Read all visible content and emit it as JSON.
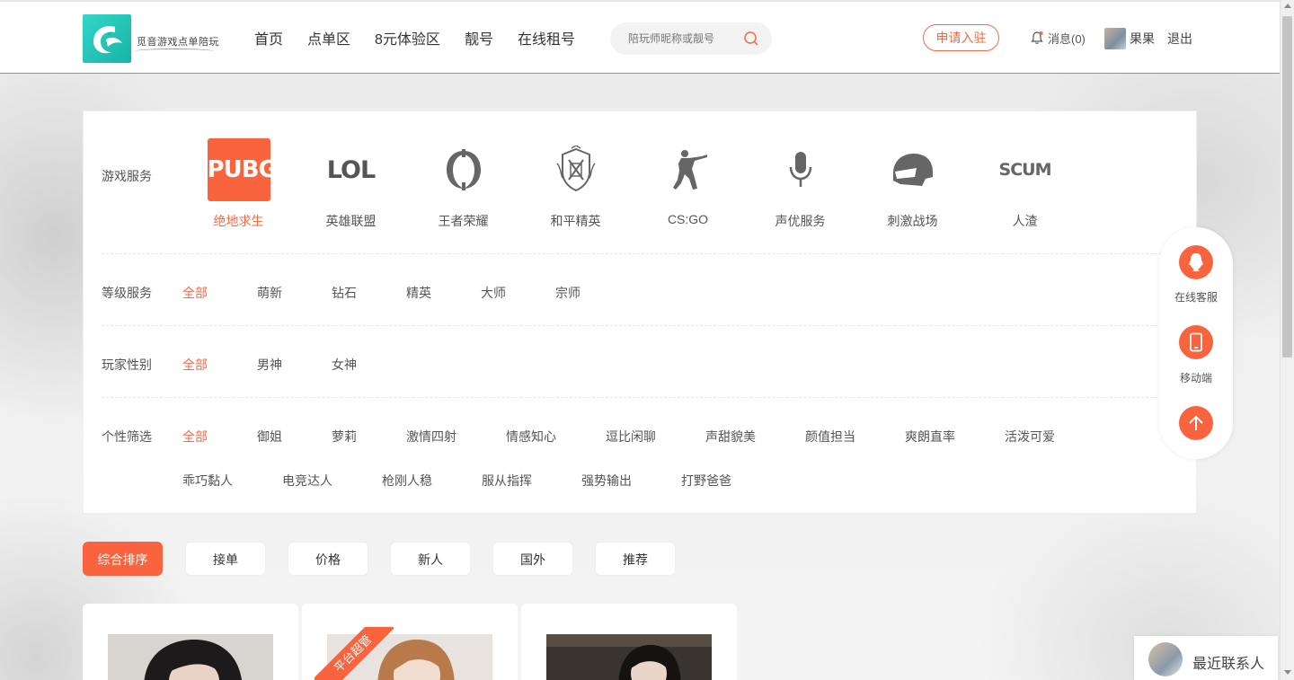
{
  "header": {
    "logo_text": "觅音游戏点单陪玩",
    "nav": [
      "首页",
      "点单区",
      "8元体验区",
      "靓号",
      "在线租号"
    ],
    "search_placeholder": "陪玩师昵称或靓号",
    "apply_label": "申请入驻",
    "message_label": "消息(0)",
    "username": "果果",
    "logout_label": "退出"
  },
  "filters": {
    "game_label": "游戏服务",
    "games": [
      {
        "name": "绝地求生",
        "icon": "pubg-logo",
        "active": true
      },
      {
        "name": "英雄联盟",
        "icon": "lol-logo",
        "active": false
      },
      {
        "name": "王者荣耀",
        "icon": "honor-of-kings-logo",
        "active": false
      },
      {
        "name": "和平精英",
        "icon": "peace-elite-logo",
        "active": false
      },
      {
        "name": "CS:GO",
        "icon": "csgo-logo",
        "active": false
      },
      {
        "name": "声优服务",
        "icon": "microphone-icon",
        "active": false
      },
      {
        "name": "刺激战场",
        "icon": "helmet-icon",
        "active": false
      },
      {
        "name": "人渣",
        "icon": "scum-logo",
        "active": false
      }
    ],
    "game_logo_text": {
      "pubg": "PUBG",
      "lol": "LOL",
      "scum": "SCUM"
    },
    "level_label": "等级服务",
    "levels": [
      "全部",
      "萌新",
      "钻石",
      "精英",
      "大师",
      "宗师"
    ],
    "gender_label": "玩家性别",
    "genders": [
      "全部",
      "男神",
      "女神"
    ],
    "personality_label": "个性筛选",
    "personality_row1": [
      "全部",
      "御姐",
      "萝莉",
      "激情四射",
      "情感知心",
      "逗比闲聊",
      "声甜貌美",
      "颜值担当",
      "爽朗直率",
      "活泼可爱"
    ],
    "personality_row2": [
      "乖巧黏人",
      "电竞达人",
      "枪刚人稳",
      "服从指挥",
      "强势输出",
      "打野爸爸"
    ]
  },
  "sort_tabs": [
    "综合排序",
    "接单",
    "价格",
    "新人",
    "国外",
    "推荐"
  ],
  "cards": {
    "ribbon_label": "平台超管"
  },
  "float_bar": {
    "service_label": "在线客服",
    "mobile_label": "移动端"
  },
  "recent_contacts": {
    "label": "最近联系人"
  },
  "colors": {
    "accent": "#f9633e",
    "active_text": "#f06a44"
  }
}
